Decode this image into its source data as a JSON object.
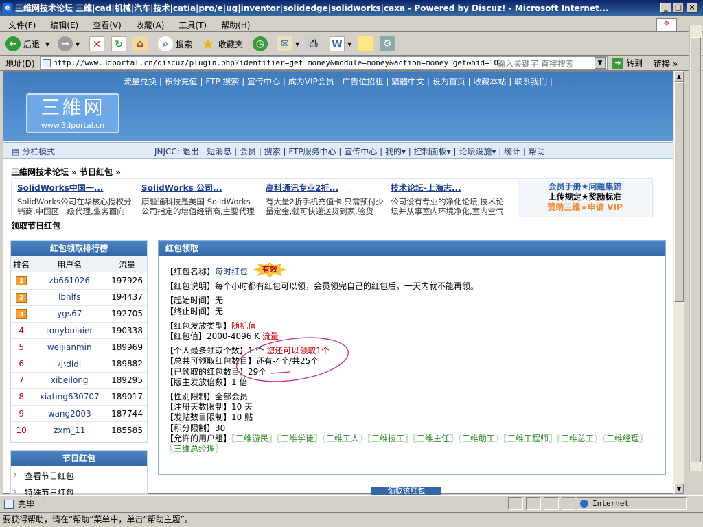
{
  "window": {
    "title": "三维网技术论坛 三维|cad|机械|汽车|技术|catia|pro/e|ug|inventor|solidedge|solidworks|caxa - Powered by Discuz! - Microsoft Internet...",
    "min": "_",
    "max": "□",
    "close": "×"
  },
  "menu": [
    "文件(F)",
    "编辑(E)",
    "查看(V)",
    "收藏(A)",
    "工具(T)",
    "帮助(H)"
  ],
  "toolbar": {
    "back": "后退",
    "search": "搜索",
    "favorites": "收藏夹"
  },
  "address": {
    "label": "地址(D)",
    "url": "http://www.3dportal.cn/discuz/plugin.php?identifier=get_money&module=money&action=money_get&hid=10",
    "search_hint": "输入关键字 直接搜索",
    "go": "转到",
    "links": "链接 »"
  },
  "site": {
    "top_links": "流量兑换 | 积分充值 | FTP 搜索 | 宣传中心 | 成为VIP会员 | 广告位招租 | 繁體中文 | 设为首页 | 收藏本站 | 联系我们 |",
    "logo_big": "三維网",
    "logo_small": "www.3dportal.cn",
    "split_mode": "分栏模式",
    "nav": "JNJCC: 退出 | 短消息 | 会员 | 搜索 | FTP服务中心 | 宣传中心 | 我的▾ | 控制面板▾ | 论坛设施▾ | 统计 | 帮助",
    "breadcrumb": "三維网技术论坛 » 节日红包 »",
    "page_heading": "领取节日红包"
  },
  "ads": [
    {
      "title": "SolidWorks中国一...",
      "desc": "SolidWorks公司在华核心授权分销商,中国区一级代理,业务面向"
    },
    {
      "title": "SolidWorks 公司...",
      "desc": "康融通科技是美国 SolidWorks 公司指定的增值经销商,主要代理"
    },
    {
      "title": "高科通讯专业2折...",
      "desc": "有大量2折手机充值卡,只需预付少量定金,就可快递送货到家,验货"
    },
    {
      "title": "技术论坛-上海志...",
      "desc": "公司设有专业的净化论坛,技术论坛并从事室内环境净化,室内空气"
    }
  ],
  "ad_side": {
    "l1": "会员手册★问题集锦",
    "l2": "上传规定★奖励标准",
    "l3": "赞助三维★申请 VIP"
  },
  "rank": {
    "title": "红包领取排行榜",
    "headers": [
      "排名",
      "用户名",
      "流量"
    ],
    "rows": [
      {
        "rank": "1",
        "user": "zb661026",
        "flow": "197926"
      },
      {
        "rank": "2",
        "user": "lbhlfs",
        "flow": "194437"
      },
      {
        "rank": "3",
        "user": "ygs67",
        "flow": "192705"
      },
      {
        "rank": "4",
        "user": "tonybulaier",
        "flow": "190338"
      },
      {
        "rank": "5",
        "user": "weijianmin",
        "flow": "189969"
      },
      {
        "rank": "6",
        "user": "小didi",
        "flow": "189882"
      },
      {
        "rank": "7",
        "user": "xibeilong",
        "flow": "189295"
      },
      {
        "rank": "8",
        "user": "xiating630707",
        "flow": "189017"
      },
      {
        "rank": "9",
        "user": "wang2003",
        "flow": "187744"
      },
      {
        "rank": "10",
        "user": "zxm_11",
        "flow": "185585"
      }
    ]
  },
  "festival": {
    "title": "节日红包",
    "items": [
      "查看节日红包",
      "特殊节日红包"
    ]
  },
  "detail": {
    "title": "红包领取",
    "valid_badge": "有效",
    "name_label": "【红包名称】",
    "name_value": "每时红包",
    "desc_label": "【红包说明】",
    "desc_value": "每个小时都有红包可以领，会员领完自己的红包后，一天内就不能再领。",
    "start_label": "【起始时间】",
    "start_value": "无",
    "end_label": "【终止时间】",
    "end_value": "无",
    "type_label": "【红包发放类型】",
    "type_value": "随机值",
    "value_label": "【红包值】",
    "value_value": "2000-4096 K",
    "value_unit": "流量",
    "max_label": "【个人最多领取个数】",
    "max_value": "1 个",
    "max_note": "您还可以领取1个",
    "total_label": "【总共可领取红包数目】",
    "total_value": "还有-4个/共25个",
    "got_label": "【已领取的红包数目】",
    "got_value": "29个",
    "mult_label": "【版主发放倍数】",
    "mult_value": "1 倍",
    "gender_label": "【性别限制】",
    "gender_value": "全部会员",
    "days_label": "【注册天数限制】",
    "days_value": "10 天",
    "posts_label": "【发贴数目限制】",
    "posts_value": "10 贴",
    "points_label": "【积分限制】",
    "points_value": "30",
    "groups_label": "【允许的用户组】",
    "groups": "〖三维游民〗〖三维学徒〗〖三维工人〗〖三维技工〗〖三维主任〗〖三维助工〗〖三维工程师〗〖三维总工〗〖三维经理〗〖三维总经理〗",
    "claim_button": "领取该红包"
  },
  "status": {
    "done": "完毕",
    "zone": "Internet"
  },
  "help": "要获得帮助，请在“帮助”菜单中，单击“帮助主题”。"
}
